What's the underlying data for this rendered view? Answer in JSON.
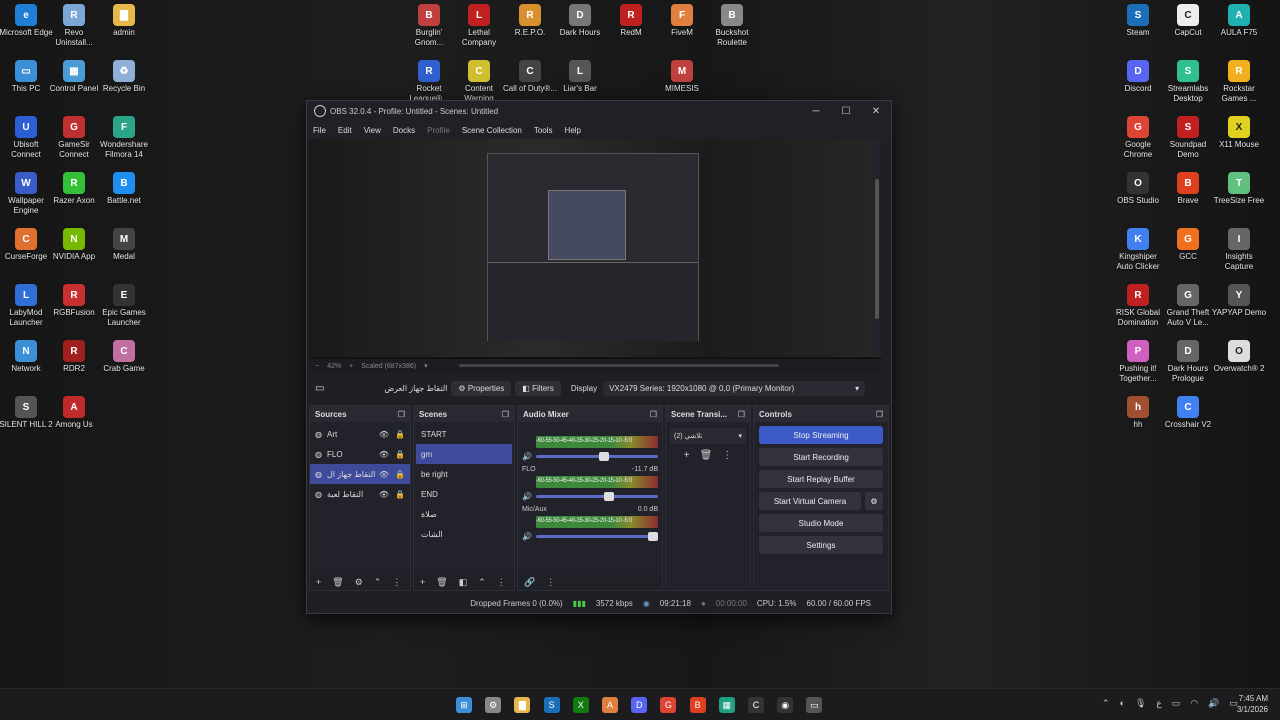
{
  "desktop": {
    "left_icons": [
      {
        "label": "Microsoft Edge",
        "color": "#1f7fd6",
        "glyph": "e"
      },
      {
        "label": "Revo Uninstall...",
        "color": "#7aa7d6",
        "glyph": "R"
      },
      {
        "label": "admin",
        "color": "#e6b84a",
        "glyph": "▇"
      },
      {
        "label": "This PC",
        "color": "#3b8fd6",
        "glyph": "▭"
      },
      {
        "label": "Control Panel",
        "color": "#4a9bd6",
        "glyph": "▦"
      },
      {
        "label": "Recycle Bin",
        "color": "#8fb0d6",
        "glyph": "♻"
      },
      {
        "label": "Ubisoft Connect",
        "color": "#2b5fd6",
        "glyph": "U"
      },
      {
        "label": "GameSir Connect",
        "color": "#c03030",
        "glyph": "G"
      },
      {
        "label": "Wondershare Filmora 14",
        "color": "#2aa58a",
        "glyph": "F"
      },
      {
        "label": "Wallpaper Engine",
        "color": "#3a5cc8",
        "glyph": "W"
      },
      {
        "label": "Razer Axon",
        "color": "#35c03a",
        "glyph": "R"
      },
      {
        "label": "Battle.net",
        "color": "#1e8ff0",
        "glyph": "B"
      },
      {
        "label": "CurseForge",
        "color": "#e07030",
        "glyph": "C"
      },
      {
        "label": "NVIDIA App",
        "color": "#76b900",
        "glyph": "N"
      },
      {
        "label": "Medal",
        "color": "#444",
        "glyph": "M"
      },
      {
        "label": "LabyMod Launcher",
        "color": "#2f6fd6",
        "glyph": "L"
      },
      {
        "label": "RGBFusion",
        "color": "#c82f2f",
        "glyph": "R"
      },
      {
        "label": "Epic Games Launcher",
        "color": "#333",
        "glyph": "E"
      },
      {
        "label": "Network",
        "color": "#3b8fd6",
        "glyph": "N"
      },
      {
        "label": "RDR2",
        "color": "#a02020",
        "glyph": "R"
      },
      {
        "label": "Crab Game",
        "color": "#c070a0",
        "glyph": "C"
      },
      {
        "label": "SILENT HILL 2",
        "color": "#555",
        "glyph": "S"
      },
      {
        "label": "Among Us",
        "color": "#c02a2a",
        "glyph": "A"
      }
    ],
    "mid_icons": [
      {
        "label": "Burglin' Gnom...",
        "color": "#c04040",
        "glyph": "B"
      },
      {
        "label": "Lethal Company",
        "color": "#c02020",
        "glyph": "L"
      },
      {
        "label": "R.E.P.O.",
        "color": "#d89030",
        "glyph": "R"
      },
      {
        "label": "Dark Hours",
        "color": "#777",
        "glyph": "D"
      },
      {
        "label": "RedM",
        "color": "#c02020",
        "glyph": "R"
      },
      {
        "label": "FiveM",
        "color": "#e08040",
        "glyph": "F"
      },
      {
        "label": "Buckshot Roulette",
        "color": "#888",
        "glyph": "B"
      },
      {
        "label": "Rocket League®...",
        "color": "#3060d0",
        "glyph": "R"
      },
      {
        "label": "Content Warning",
        "color": "#d0c030",
        "glyph": "C"
      },
      {
        "label": "Call of Duty®...",
        "color": "#444",
        "glyph": "C"
      },
      {
        "label": "Liar's Bar",
        "color": "#555",
        "glyph": "L"
      },
      {
        "label": "MIMESIS",
        "color": "#c04040",
        "glyph": "M"
      }
    ],
    "right_icons": [
      {
        "label": "Steam",
        "color": "#1b6fb8",
        "glyph": "S"
      },
      {
        "label": "CapCut",
        "color": "#eee",
        "glyph": "C"
      },
      {
        "label": "AULA F75",
        "color": "#20b0b0",
        "glyph": "A"
      },
      {
        "label": "Discord",
        "color": "#5865f2",
        "glyph": "D"
      },
      {
        "label": "Streamlabs Desktop",
        "color": "#30c090",
        "glyph": "S"
      },
      {
        "label": "Rockstar Games ...",
        "color": "#f0b020",
        "glyph": "R"
      },
      {
        "label": "Google Chrome",
        "color": "#dd4433",
        "glyph": "G"
      },
      {
        "label": "Soundpad Demo",
        "color": "#c02020",
        "glyph": "S"
      },
      {
        "label": "X11 Mouse",
        "color": "#e0d020",
        "glyph": "X"
      },
      {
        "label": "OBS Studio",
        "color": "#333",
        "glyph": "O"
      },
      {
        "label": "Brave",
        "color": "#e04020",
        "glyph": "B"
      },
      {
        "label": "TreeSize Free",
        "color": "#60c080",
        "glyph": "T"
      },
      {
        "label": "Kingshiper Auto Clicker",
        "color": "#4080f0",
        "glyph": "K"
      },
      {
        "label": "GCC",
        "color": "#f07020",
        "glyph": "G"
      },
      {
        "label": "Insights Capture",
        "color": "#666",
        "glyph": "I"
      },
      {
        "label": "RISK Global Domination",
        "color": "#c02020",
        "glyph": "R"
      },
      {
        "label": "Grand Theft Auto V Le...",
        "color": "#666",
        "glyph": "G"
      },
      {
        "label": "YAPYAP Demo",
        "color": "#555",
        "glyph": "Y"
      },
      {
        "label": "Pushing it! Together...",
        "color": "#d060c0",
        "glyph": "P"
      },
      {
        "label": "Dark Hours Prologue",
        "color": "#666",
        "glyph": "D"
      },
      {
        "label": "Overwatch® 2",
        "color": "#ddd",
        "glyph": "O"
      },
      {
        "label": "hh",
        "color": "#a05030",
        "glyph": "h"
      },
      {
        "label": "Crosshair V2",
        "color": "#4080f0",
        "glyph": "C"
      }
    ]
  },
  "obs": {
    "title": "OBS 32.0.4 - Profile: Untitled - Scenes: Untitled",
    "menu": [
      "File",
      "Edit",
      "View",
      "Docks",
      "Profile",
      "Scene Collection",
      "Tools",
      "Help"
    ],
    "zoom": "42%",
    "scaled": "Scaled (687x386)",
    "context": {
      "source_name": "التقاط جهاز العرض",
      "properties": "Properties",
      "filters": "Filters",
      "display_label": "Display",
      "display_value": "VX2479 Series: 1920x1080 @ 0,0 (Primary Monitor)"
    },
    "sources": {
      "title": "Sources",
      "items": [
        {
          "name": "Art",
          "selected": false
        },
        {
          "name": "FLO",
          "selected": false
        },
        {
          "name": "التقاط جهاز ال",
          "selected": true
        },
        {
          "name": "التقاط لعبة",
          "selected": false
        }
      ]
    },
    "scenes": {
      "title": "Scenes",
      "items": [
        {
          "name": "START",
          "selected": false
        },
        {
          "name": "gm",
          "selected": true
        },
        {
          "name": "be right",
          "selected": false
        },
        {
          "name": "END",
          "selected": false
        },
        {
          "name": "صلاة",
          "selected": false
        },
        {
          "name": "الشات",
          "selected": false
        }
      ]
    },
    "mixer": {
      "title": "Audio Mixer",
      "scale": "-60-55-50-45-40-35-30-25-20-15-10 -5 0",
      "tracks": [
        {
          "name": "",
          "db": "",
          "level": 0.6
        },
        {
          "name": "FLO",
          "db": "-11.7 dB",
          "level": 0.64
        },
        {
          "name": "Mic/Aux",
          "db": "0.0 dB",
          "level": 1.0
        }
      ]
    },
    "transitions": {
      "title": "Scene Transi...",
      "selected": "تلاشي (2)"
    },
    "controls": {
      "title": "Controls",
      "buttons": [
        "Stop Streaming",
        "Start Recording",
        "Start Replay Buffer",
        "Start Virtual Camera",
        "Studio Mode",
        "Settings"
      ]
    },
    "status": {
      "dropped": "Dropped Frames 0 (0.0%)",
      "bitrate": "3572 kbps",
      "stream_time": "09:21:18",
      "rec_time": "00:00:00",
      "cpu": "CPU: 1.5%",
      "fps": "60.00 / 60.00 FPS"
    }
  },
  "taskbar": {
    "time": "7:45 AM",
    "date": "3/1/2026",
    "lang": "ع"
  }
}
